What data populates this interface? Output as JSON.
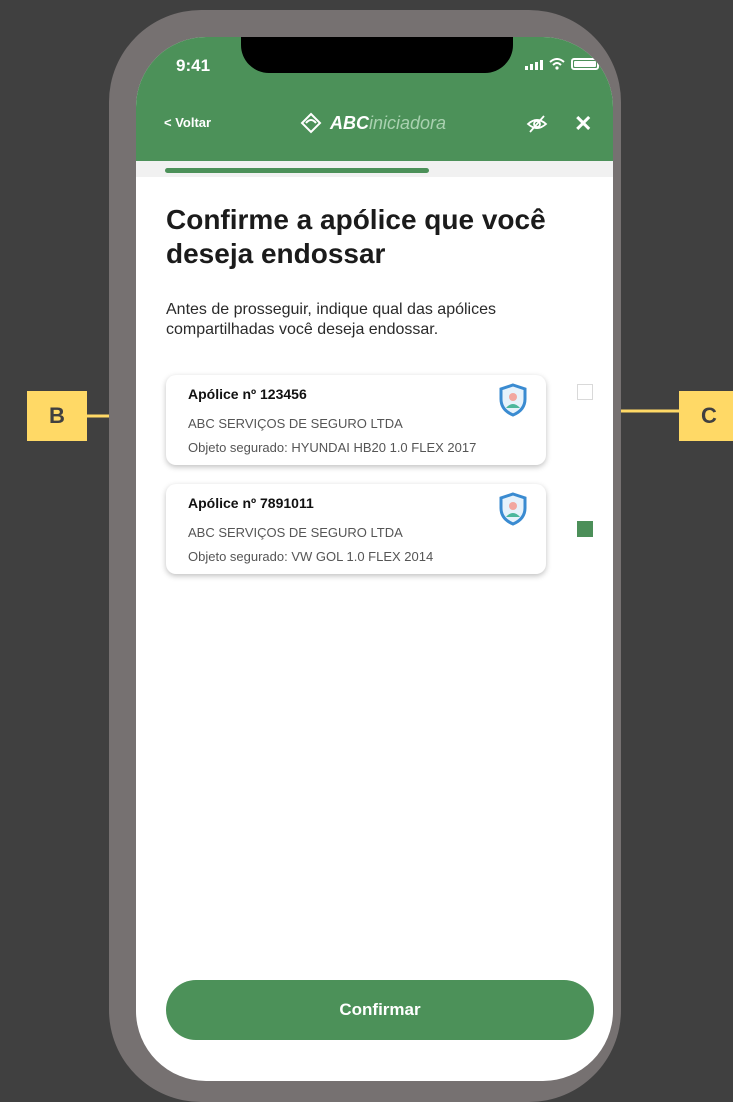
{
  "status_bar": {
    "time": "9:41"
  },
  "nav": {
    "back_label": "< Voltar",
    "brand_bold": "ABC",
    "brand_light": "iniciadora"
  },
  "progress": {
    "fraction": 0.62
  },
  "page": {
    "title": "Confirme a apólice que você deseja endossar",
    "description": "Antes de prosseguir, indique qual das apólices compartilhadas você deseja endossar."
  },
  "policies": [
    {
      "title": "Apólice nº 123456",
      "insurer": "ABC SERVIÇOS DE SEGURO LTDA",
      "object": "Objeto segurado: HYUNDAI HB20 1.0 FLEX 2017",
      "selected": false
    },
    {
      "title": "Apólice nº 7891011",
      "insurer": "ABC SERVIÇOS DE SEGURO LTDA",
      "object": "Objeto segurado: VW GOL 1.0 FLEX 2014",
      "selected": true
    }
  ],
  "confirm_label": "Confirmar",
  "annotations": {
    "b_label": "B",
    "c_label": "C"
  },
  "colors": {
    "background": "#404040",
    "phone_frame": "#767171",
    "header_green": "#4c9159",
    "callout_yellow": "#ffd966",
    "shield_blue": "#3a8bd1",
    "checkbox_checked": "#4c8f59"
  }
}
